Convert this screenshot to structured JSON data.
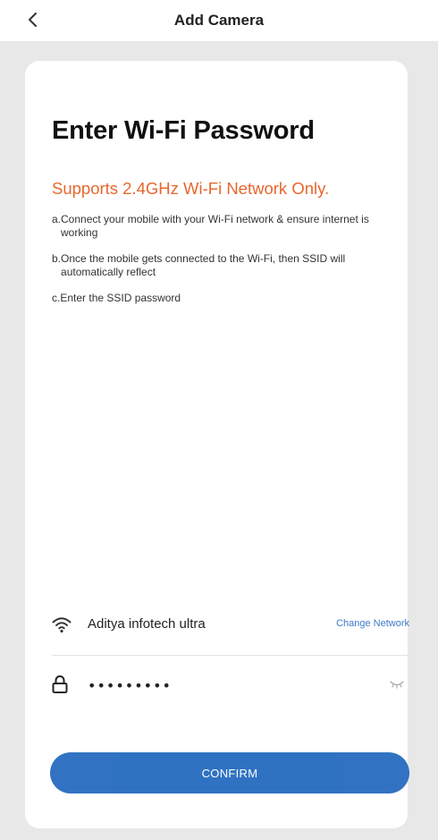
{
  "header": {
    "title": "Add Camera",
    "back_icon": "chevron-left-icon"
  },
  "card": {
    "heading": "Enter Wi-Fi Password",
    "subheading": "Supports 2.4GHz Wi-Fi Network Only.",
    "instructions": [
      {
        "prefix": "a.",
        "text": "Connect your mobile with your Wi-Fi network & ensure internet is working"
      },
      {
        "prefix": "b.",
        "text": "Once the mobile gets connected to the Wi-Fi, then SSID will automatically reflect"
      },
      {
        "prefix": "c.",
        "text": "Enter the SSID password"
      }
    ]
  },
  "network": {
    "icon": "wifi-icon",
    "ssid": "Aditya infotech ultra",
    "change_label": "Change Network"
  },
  "password": {
    "icon": "lock-icon",
    "value": "•••••••••",
    "toggle_icon": "eye-closed-icon"
  },
  "confirm_label": "CONFIRM",
  "colors": {
    "accent_orange": "#e8672e",
    "primary_blue": "#1f67bd",
    "link_blue": "#3d79c8",
    "background_gray": "#e8e8e8"
  }
}
